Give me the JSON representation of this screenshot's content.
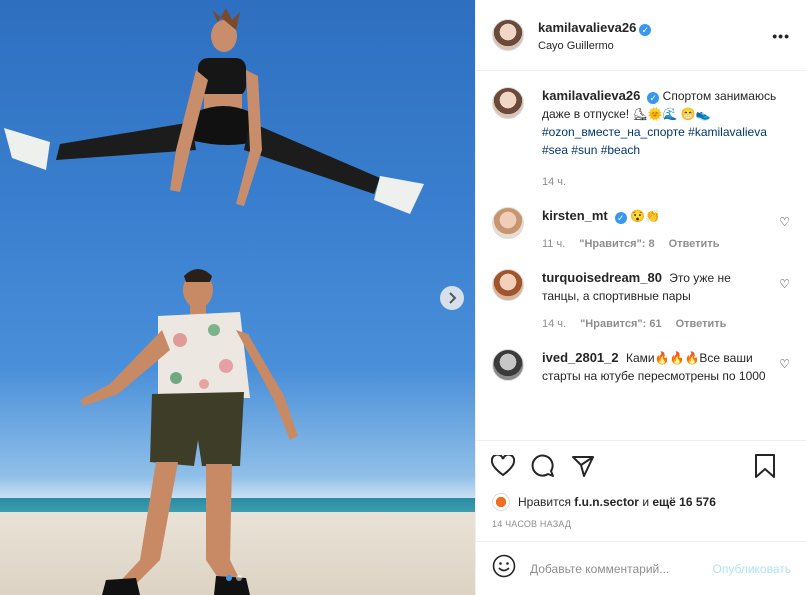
{
  "post": {
    "username": "kamilavalieva26",
    "location": "Cayo Guillermo"
  },
  "caption": {
    "username": "kamilavalieva26",
    "text": "Спортом занимаюсь даже в отпуске! ⛸🌞🌊 😁👟",
    "hashtags": "#ozon_вместе_на_спорте #kamilavalieva #sea #sun #beach",
    "time": "14 ч."
  },
  "comments": [
    {
      "username": "kirsten_mt",
      "verified": true,
      "text": "😯👏",
      "time": "11 ч.",
      "likes": "\"Нравится\": 8",
      "reply": "Ответить"
    },
    {
      "username": "turquoisedream_80",
      "verified": false,
      "text": "Это уже не танцы, а спортивные пары",
      "time": "14 ч.",
      "likes": "\"Нравится\": 61",
      "reply": "Ответить"
    },
    {
      "username": "ived_2801_2",
      "verified": false,
      "text": "Ками🔥🔥🔥Все ваши старты на ютубе пересмотрены по 1000",
      "time": "",
      "likes": "",
      "reply": ""
    }
  ],
  "likes_line": {
    "prefix": "Нравится",
    "user": "f.u.n.sector",
    "middle": "и",
    "rest": "ещё 16 576"
  },
  "timestamp": "14 ЧАСОВ НАЗАД",
  "comment_box": {
    "placeholder": "Добавьте комментарий...",
    "publish": "Опубликовать"
  },
  "colors": {
    "accent": "#3897f0",
    "link": "#00376b",
    "muted": "#8e8e8e"
  }
}
